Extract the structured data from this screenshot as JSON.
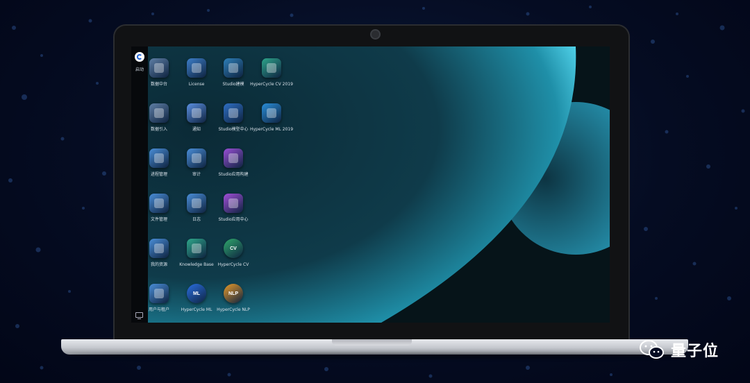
{
  "taskbar": {
    "start_label": "启动"
  },
  "desktop": {
    "icons": [
      {
        "label": "数据中台",
        "icon": "data-platform-icon",
        "color": "#5f7fa6"
      },
      {
        "label": "License",
        "icon": "license-icon",
        "color": "#3d7ec9"
      },
      {
        "label": "Studio建模",
        "icon": "studio-modeling-icon",
        "color": "#2e7fb8"
      },
      {
        "label": "HyperCycle CV 2019",
        "icon": "hypercycle-cv-2019-icon",
        "color": "#2ea58a"
      },
      {
        "label": "数据引入",
        "icon": "data-import-icon",
        "color": "#5f7fa6"
      },
      {
        "label": "通知",
        "icon": "bell-icon",
        "color": "#5b8fe0"
      },
      {
        "label": "Studio模型中心",
        "icon": "studio-model-center-icon",
        "color": "#2f6fc4"
      },
      {
        "label": "HyperCycle ML 2019",
        "icon": "hypercycle-ml-2019-icon",
        "color": "#2a8ed8"
      },
      {
        "label": "进程管理",
        "icon": "process-manager-icon",
        "color": "#4a8ed8"
      },
      {
        "label": "审计",
        "icon": "audit-icon",
        "color": "#4a8ed8"
      },
      {
        "label": "Studio应用构建",
        "icon": "studio-app-builder-icon",
        "color": "#9a4fd6"
      },
      {
        "label": "文件管理",
        "icon": "file-manager-icon",
        "color": "#4a8ed8"
      },
      {
        "label": "日志",
        "icon": "log-icon",
        "color": "#4a8ed8"
      },
      {
        "label": "Studio应用中心",
        "icon": "studio-app-center-icon",
        "color": "#a24fd8"
      },
      {
        "label": "我的资源",
        "icon": "my-resources-icon",
        "color": "#4a8ed8"
      },
      {
        "label": "Knowledge Base",
        "icon": "knowledge-base-icon",
        "color": "#2fa88a"
      },
      {
        "label": "HyperCycle CV",
        "icon": "hypercycle-cv-icon",
        "color": "#30a96c",
        "glyph": "CV"
      },
      {
        "label": "用户与租户",
        "icon": "users-tenants-icon",
        "color": "#4a8ed8"
      },
      {
        "label": "HyperCycle ML",
        "icon": "hypercycle-ml-icon",
        "color": "#2a6ee0",
        "glyph": "ML"
      },
      {
        "label": "HyperCycle NLP",
        "icon": "hypercycle-nlp-icon",
        "color": "#e89a2a",
        "glyph": "NLP"
      }
    ]
  },
  "watermark": {
    "text": "量子位",
    "icon": "wechat-icon"
  }
}
